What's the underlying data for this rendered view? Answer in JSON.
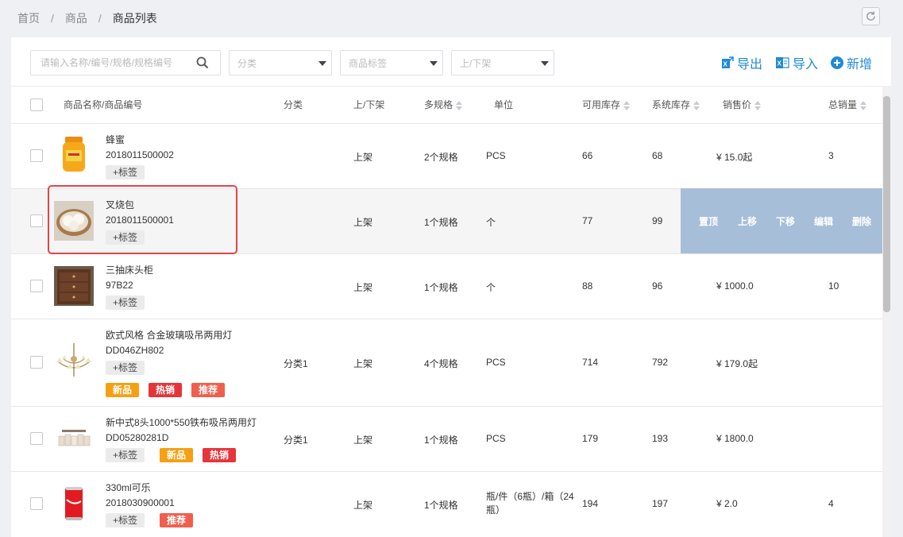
{
  "breadcrumb": {
    "items": [
      "首页",
      "商品",
      "商品列表"
    ],
    "sep": "/"
  },
  "toolbar": {
    "search_placeholder": "请输入名称/编号/规格/规格编号",
    "category_placeholder": "分类",
    "tag_placeholder": "商品标签",
    "status_placeholder": "上/下架",
    "export_label": "导出",
    "import_label": "导入",
    "add_label": "新增"
  },
  "columns": {
    "name": "商品名称/商品编号",
    "category": "分类",
    "status": "上/下架",
    "spec": "多规格",
    "unit": "单位",
    "available": "可用库存",
    "system": "系统库存",
    "price": "销售价",
    "sales": "总销量"
  },
  "tag_button_label": "+标签",
  "row_actions": [
    "置顶",
    "上移",
    "下移",
    "编辑",
    "删除"
  ],
  "rows": [
    {
      "name": "蜂蜜",
      "code": "2018011500002",
      "category": "",
      "status": "上架",
      "spec": "2个规格",
      "unit": "PCS",
      "available": "66",
      "system": "68",
      "price": "¥ 15.0起",
      "sales": "3",
      "badges": []
    },
    {
      "name": "叉烧包",
      "code": "2018011500001",
      "category": "",
      "status": "上架",
      "spec": "1个规格",
      "unit": "个",
      "available": "77",
      "system": "99",
      "price": "",
      "sales": "",
      "badges": []
    },
    {
      "name": "三抽床头柜",
      "code": "97B22",
      "category": "",
      "status": "上架",
      "spec": "1个规格",
      "unit": "个",
      "available": "88",
      "system": "96",
      "price": "¥ 1000.0",
      "sales": "10",
      "badges": []
    },
    {
      "name": "欧式风格 合金玻璃吸吊两用灯",
      "code": "DD046ZH802",
      "category": "分类1",
      "status": "上架",
      "spec": "4个规格",
      "unit": "PCS",
      "available": "714",
      "system": "792",
      "price": "¥ 179.0起",
      "sales": "",
      "badges": [
        "新品",
        "热销",
        "推荐"
      ]
    },
    {
      "name": "新中式8头1000*550铁布吸吊两用灯",
      "code": "DD05280281D",
      "category": "分类1",
      "status": "上架",
      "spec": "1个规格",
      "unit": "PCS",
      "available": "179",
      "system": "193",
      "price": "¥ 1800.0",
      "sales": "",
      "badges": [
        "新品",
        "热销"
      ]
    },
    {
      "name": "330ml可乐",
      "code": "2018030900001",
      "category": "",
      "status": "上架",
      "spec": "1个规格",
      "unit": "瓶/件（6瓶）/箱（24瓶）",
      "available": "194",
      "system": "197",
      "price": "¥ 2.0",
      "sales": "4",
      "badges": [
        "推荐"
      ]
    }
  ],
  "badge_colors": {
    "新品": "#f5a012",
    "热销": "#e5343a",
    "推荐": "#f05f4e"
  },
  "accent_color": "#1f8ad6"
}
